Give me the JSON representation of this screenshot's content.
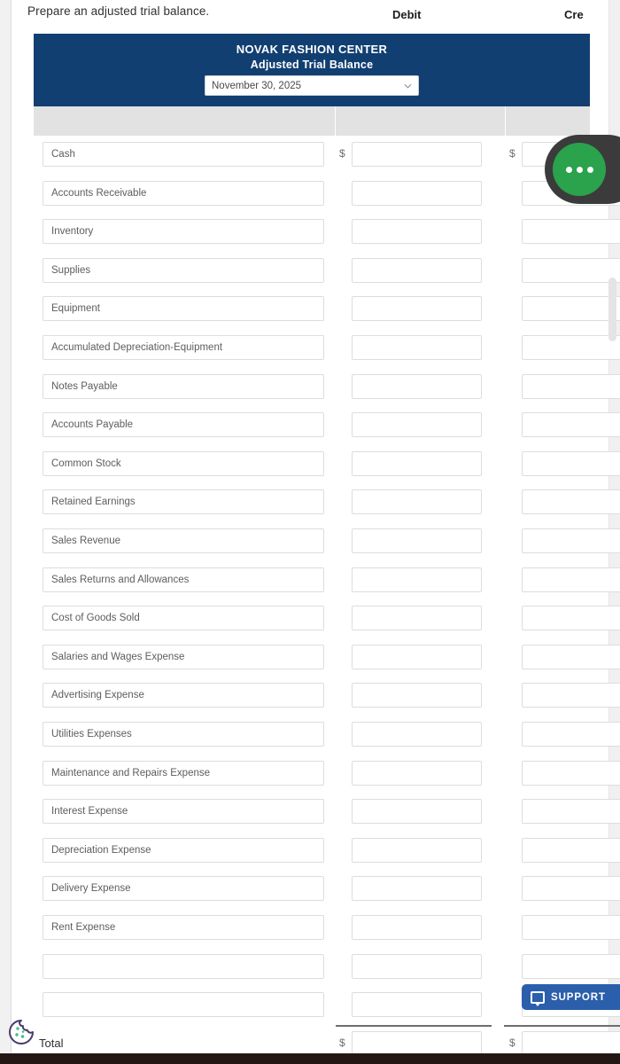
{
  "prompt": {
    "text": "Prepare an adjusted trial balance."
  },
  "report": {
    "company": "NOVAK FASHION CENTER",
    "title": "Adjusted Trial Balance",
    "date_value": "November 30, 2025",
    "date_options": [
      "November 30, 2025"
    ]
  },
  "columns": {
    "debit": "Debit",
    "credit": "Credit (truncated: \"Cre\")",
    "credit_visible": "Cre"
  },
  "currency_symbol": "$",
  "rows": [
    {
      "account": "Cash",
      "debit": "",
      "credit": "",
      "show_dollar": true
    },
    {
      "account": "Accounts Receivable",
      "debit": "",
      "credit": "",
      "show_dollar": false
    },
    {
      "account": "Inventory",
      "debit": "",
      "credit": "",
      "show_dollar": false
    },
    {
      "account": "Supplies",
      "debit": "",
      "credit": "",
      "show_dollar": false
    },
    {
      "account": "Equipment",
      "debit": "",
      "credit": "",
      "show_dollar": false
    },
    {
      "account": "Accumulated Depreciation-Equipment",
      "debit": "",
      "credit": "",
      "show_dollar": false
    },
    {
      "account": "Notes Payable",
      "debit": "",
      "credit": "",
      "show_dollar": false
    },
    {
      "account": "Accounts Payable",
      "debit": "",
      "credit": "",
      "show_dollar": false
    },
    {
      "account": "Common Stock",
      "debit": "",
      "credit": "",
      "show_dollar": false
    },
    {
      "account": "Retained Earnings",
      "debit": "",
      "credit": "",
      "show_dollar": false
    },
    {
      "account": "Sales Revenue",
      "debit": "",
      "credit": "",
      "show_dollar": false
    },
    {
      "account": "Sales Returns and Allowances",
      "debit": "",
      "credit": "",
      "show_dollar": false
    },
    {
      "account": "Cost of Goods Sold",
      "debit": "",
      "credit": "",
      "show_dollar": false
    },
    {
      "account": "Salaries and Wages Expense",
      "debit": "",
      "credit": "",
      "show_dollar": false
    },
    {
      "account": "Advertising Expense",
      "debit": "",
      "credit": "",
      "show_dollar": false
    },
    {
      "account": "Utilities Expenses",
      "debit": "",
      "credit": "",
      "show_dollar": false
    },
    {
      "account": "Maintenance and Repairs Expense",
      "debit": "",
      "credit": "",
      "show_dollar": false
    },
    {
      "account": "Interest Expense",
      "debit": "",
      "credit": "",
      "show_dollar": false
    },
    {
      "account": "Depreciation Expense",
      "debit": "",
      "credit": "",
      "show_dollar": false
    },
    {
      "account": "Delivery Expense",
      "debit": "",
      "credit": "",
      "show_dollar": false
    },
    {
      "account": "Rent Expense",
      "debit": "",
      "credit": "",
      "show_dollar": false
    },
    {
      "account": "",
      "debit": "",
      "credit": "",
      "show_dollar": false
    },
    {
      "account": "",
      "debit": "",
      "credit": "",
      "show_dollar": false
    }
  ],
  "total": {
    "label": "Total",
    "debit": "",
    "credit": ""
  },
  "support": {
    "label": "SUPPORT"
  },
  "fab": {
    "label": "more-options"
  },
  "colors": {
    "header_navy": "#123f72",
    "col_head_grey": "#e2e2e2",
    "fab_green": "#2ba24c",
    "fab_ring": "#3b3b3b",
    "support_blue": "#2b5fab",
    "cookie_outline": "#4a3a6b",
    "cookie_dots": "#3fc07f",
    "bottom_bar": "#241613"
  }
}
